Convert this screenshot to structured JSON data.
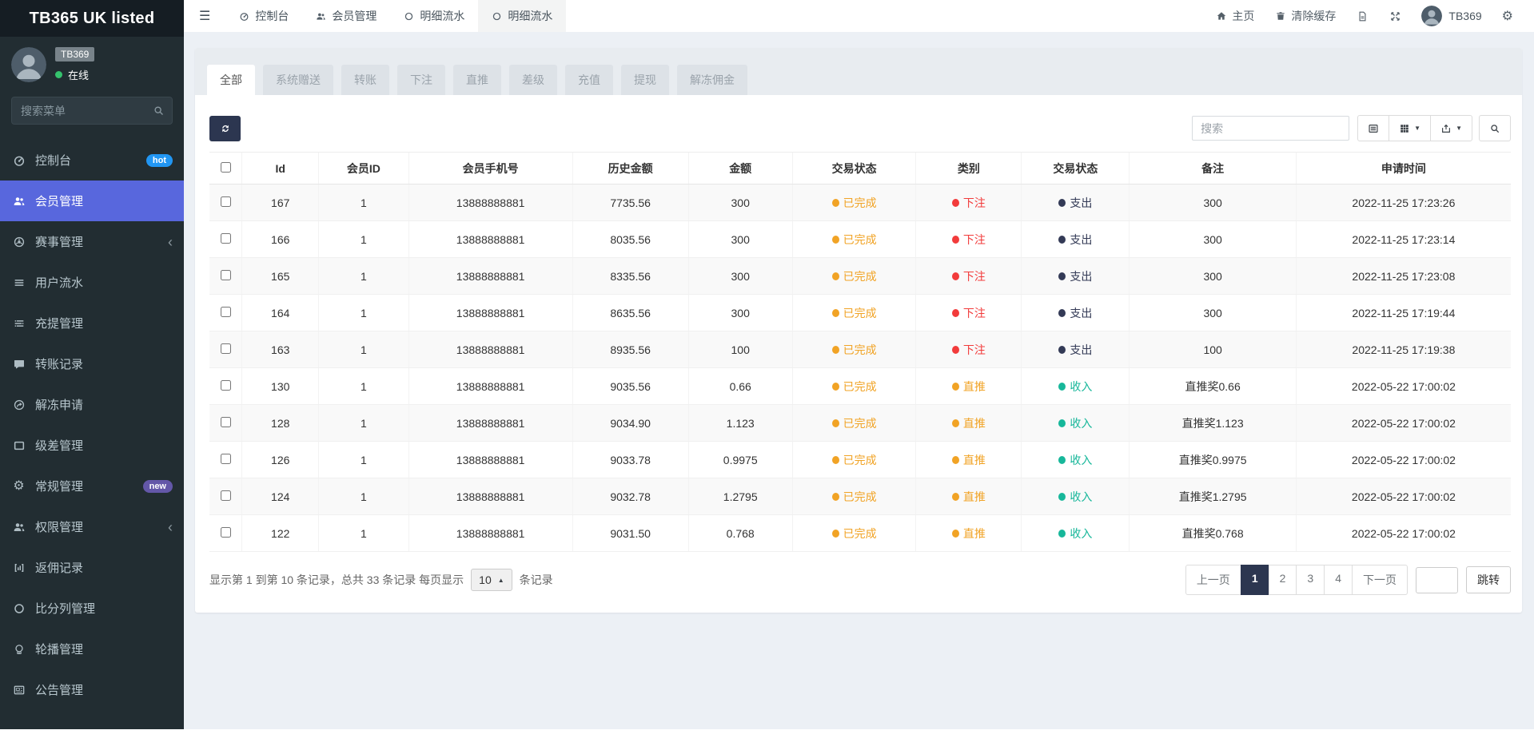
{
  "sidebar": {
    "brand": "TB365 UK listed",
    "user": {
      "name": "TB369",
      "status": "在线"
    },
    "search_placeholder": "搜索菜单",
    "items": [
      {
        "label": "控制台",
        "icon": "dashboard-icon",
        "badge": "hot",
        "badge_color": "#2196f3"
      },
      {
        "label": "会员管理",
        "icon": "users-icon",
        "active": true
      },
      {
        "label": "赛事管理",
        "icon": "soccer-icon",
        "chevron": true
      },
      {
        "label": "用户流水",
        "icon": "list-icon"
      },
      {
        "label": "充提管理",
        "icon": "tasks-icon"
      },
      {
        "label": "转账记录",
        "icon": "transfer-icon"
      },
      {
        "label": "解冻申请",
        "icon": "share-icon"
      },
      {
        "label": "级差管理",
        "icon": "window-icon"
      },
      {
        "label": "常规管理",
        "icon": "gears-icon",
        "badge": "new",
        "badge_color": "#6357a8"
      },
      {
        "label": "权限管理",
        "icon": "users-icon",
        "chevron": true
      },
      {
        "label": "返佣记录",
        "icon": "chart-icon"
      },
      {
        "label": "比分列管理",
        "icon": "circle-icon"
      },
      {
        "label": "轮播管理",
        "icon": "carousel-icon"
      },
      {
        "label": "公告管理",
        "icon": "announcement-icon"
      }
    ]
  },
  "topbar": {
    "tabs": [
      {
        "label": "控制台",
        "icon": "dashboard-icon"
      },
      {
        "label": "会员管理",
        "icon": "users-icon"
      },
      {
        "label": "明细流水",
        "icon": "circle-icon"
      },
      {
        "label": "明细流水",
        "icon": "circle-icon",
        "active": true
      }
    ],
    "right": {
      "home": "主页",
      "clear_cache": "清除缓存",
      "username": "TB369"
    }
  },
  "filter_tabs": [
    {
      "label": "全部",
      "active": true
    },
    {
      "label": "系统赠送"
    },
    {
      "label": "转账"
    },
    {
      "label": "下注"
    },
    {
      "label": "直推"
    },
    {
      "label": "差级"
    },
    {
      "label": "充值"
    },
    {
      "label": "提现"
    },
    {
      "label": "解冻佣金"
    }
  ],
  "toolbar": {
    "search_placeholder": "搜索"
  },
  "table": {
    "columns": [
      "Id",
      "会员ID",
      "会员手机号",
      "历史金额",
      "金额",
      "交易状态",
      "类别",
      "交易状态",
      "备注",
      "申请时间"
    ],
    "rows": [
      {
        "id": "167",
        "member_id": "1",
        "phone": "13888888881",
        "history": "7735.56",
        "amount": "300",
        "status": "已完成",
        "category": "下注",
        "direction": "支出",
        "remark": "300",
        "time": "2022-11-25 17:23:26"
      },
      {
        "id": "166",
        "member_id": "1",
        "phone": "13888888881",
        "history": "8035.56",
        "amount": "300",
        "status": "已完成",
        "category": "下注",
        "direction": "支出",
        "remark": "300",
        "time": "2022-11-25 17:23:14"
      },
      {
        "id": "165",
        "member_id": "1",
        "phone": "13888888881",
        "history": "8335.56",
        "amount": "300",
        "status": "已完成",
        "category": "下注",
        "direction": "支出",
        "remark": "300",
        "time": "2022-11-25 17:23:08"
      },
      {
        "id": "164",
        "member_id": "1",
        "phone": "13888888881",
        "history": "8635.56",
        "amount": "300",
        "status": "已完成",
        "category": "下注",
        "direction": "支出",
        "remark": "300",
        "time": "2022-11-25 17:19:44"
      },
      {
        "id": "163",
        "member_id": "1",
        "phone": "13888888881",
        "history": "8935.56",
        "amount": "100",
        "status": "已完成",
        "category": "下注",
        "direction": "支出",
        "remark": "100",
        "time": "2022-11-25 17:19:38"
      },
      {
        "id": "130",
        "member_id": "1",
        "phone": "13888888881",
        "history": "9035.56",
        "amount": "0.66",
        "status": "已完成",
        "category": "直推",
        "direction": "收入",
        "remark": "直推奖0.66",
        "time": "2022-05-22 17:00:02"
      },
      {
        "id": "128",
        "member_id": "1",
        "phone": "13888888881",
        "history": "9034.90",
        "amount": "1.123",
        "status": "已完成",
        "category": "直推",
        "direction": "收入",
        "remark": "直推奖1.123",
        "time": "2022-05-22 17:00:02"
      },
      {
        "id": "126",
        "member_id": "1",
        "phone": "13888888881",
        "history": "9033.78",
        "amount": "0.9975",
        "status": "已完成",
        "category": "直推",
        "direction": "收入",
        "remark": "直推奖0.9975",
        "time": "2022-05-22 17:00:02"
      },
      {
        "id": "124",
        "member_id": "1",
        "phone": "13888888881",
        "history": "9032.78",
        "amount": "1.2795",
        "status": "已完成",
        "category": "直推",
        "direction": "收入",
        "remark": "直推奖1.2795",
        "time": "2022-05-22 17:00:02"
      },
      {
        "id": "122",
        "member_id": "1",
        "phone": "13888888881",
        "history": "9031.50",
        "amount": "0.768",
        "status": "已完成",
        "category": "直推",
        "direction": "收入",
        "remark": "直推奖0.768",
        "time": "2022-05-22 17:00:02"
      }
    ]
  },
  "status_colors": {
    "已完成": "#f1a325",
    "下注": "#f23b3b",
    "支出": "#333a56",
    "直推": "#f1a325",
    "收入": "#17b79a"
  },
  "pagination": {
    "info_prefix": "显示第 1 到第 10 条记录，总共 33 条记录 每页显示",
    "info_suffix": "条记录",
    "page_size": "10",
    "prev": "上一页",
    "pages": [
      "1",
      "2",
      "3",
      "4"
    ],
    "active_page": "1",
    "next": "下一页",
    "jump": "跳转"
  }
}
